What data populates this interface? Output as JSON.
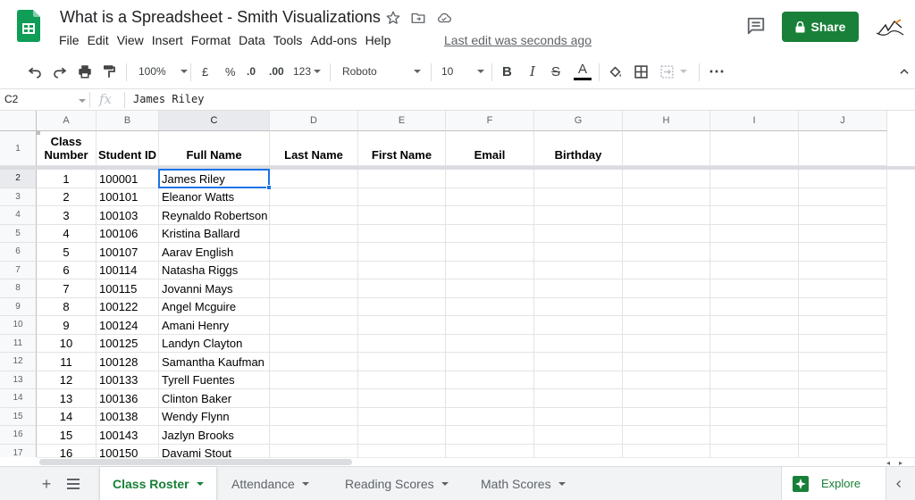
{
  "app": {
    "doc_title": "What is a Spreadsheet - Smith Visualizations",
    "last_edit": "Last edit was seconds ago",
    "share_label": "Share",
    "menu": [
      "File",
      "Edit",
      "View",
      "Insert",
      "Format",
      "Data",
      "Tools",
      "Add-ons",
      "Help"
    ],
    "accent_color": "#188038",
    "selection_color": "#1a73e8"
  },
  "toolbar": {
    "zoom": "100%",
    "currency": "£",
    "percent": "%",
    "dec_decrease": ".0",
    "dec_increase": ".00",
    "more_formats": "123",
    "font": "Roboto",
    "font_size": "10",
    "bold": "B",
    "italic": "I",
    "strike": "S",
    "text_color": "A"
  },
  "formula_bar": {
    "cell_ref": "C2",
    "fx": "fx",
    "value": "James Riley"
  },
  "grid": {
    "columns": [
      "A",
      "B",
      "C",
      "D",
      "E",
      "F",
      "G",
      "H",
      "I",
      "J"
    ],
    "selected_column": "C",
    "selected_row": "2",
    "header_row": {
      "number": "1",
      "cells": [
        "Class Number",
        "Student ID",
        "Full Name",
        "Last Name",
        "First Name",
        "Email",
        "Birthday",
        "",
        "",
        ""
      ]
    },
    "rows": [
      {
        "n": "2",
        "class": "1",
        "id": "100001",
        "name": "James Riley"
      },
      {
        "n": "3",
        "class": "2",
        "id": "100101",
        "name": "Eleanor Watts"
      },
      {
        "n": "4",
        "class": "3",
        "id": "100103",
        "name": "Reynaldo Robertson"
      },
      {
        "n": "5",
        "class": "4",
        "id": "100106",
        "name": "Kristina Ballard"
      },
      {
        "n": "6",
        "class": "5",
        "id": "100107",
        "name": "Aarav English"
      },
      {
        "n": "7",
        "class": "6",
        "id": "100114",
        "name": "Natasha Riggs"
      },
      {
        "n": "8",
        "class": "7",
        "id": "100115",
        "name": "Jovanni Mays"
      },
      {
        "n": "9",
        "class": "8",
        "id": "100122",
        "name": "Angel Mcguire"
      },
      {
        "n": "10",
        "class": "9",
        "id": "100124",
        "name": "Amani Henry"
      },
      {
        "n": "11",
        "class": "10",
        "id": "100125",
        "name": "Landyn Clayton"
      },
      {
        "n": "12",
        "class": "11",
        "id": "100128",
        "name": "Samantha Kaufman"
      },
      {
        "n": "13",
        "class": "12",
        "id": "100133",
        "name": "Tyrell Fuentes"
      },
      {
        "n": "14",
        "class": "13",
        "id": "100136",
        "name": "Clinton Baker"
      },
      {
        "n": "15",
        "class": "14",
        "id": "100138",
        "name": "Wendy Flynn"
      },
      {
        "n": "16",
        "class": "15",
        "id": "100143",
        "name": "Jazlyn Brooks"
      },
      {
        "n": "17",
        "class": "16",
        "id": "100150",
        "name": "Dayami Stout"
      }
    ]
  },
  "tabs": {
    "sheets": [
      "Class Roster",
      "Attendance",
      "Reading Scores",
      "Math Scores"
    ],
    "active": "Class Roster",
    "explore_label": "Explore"
  }
}
